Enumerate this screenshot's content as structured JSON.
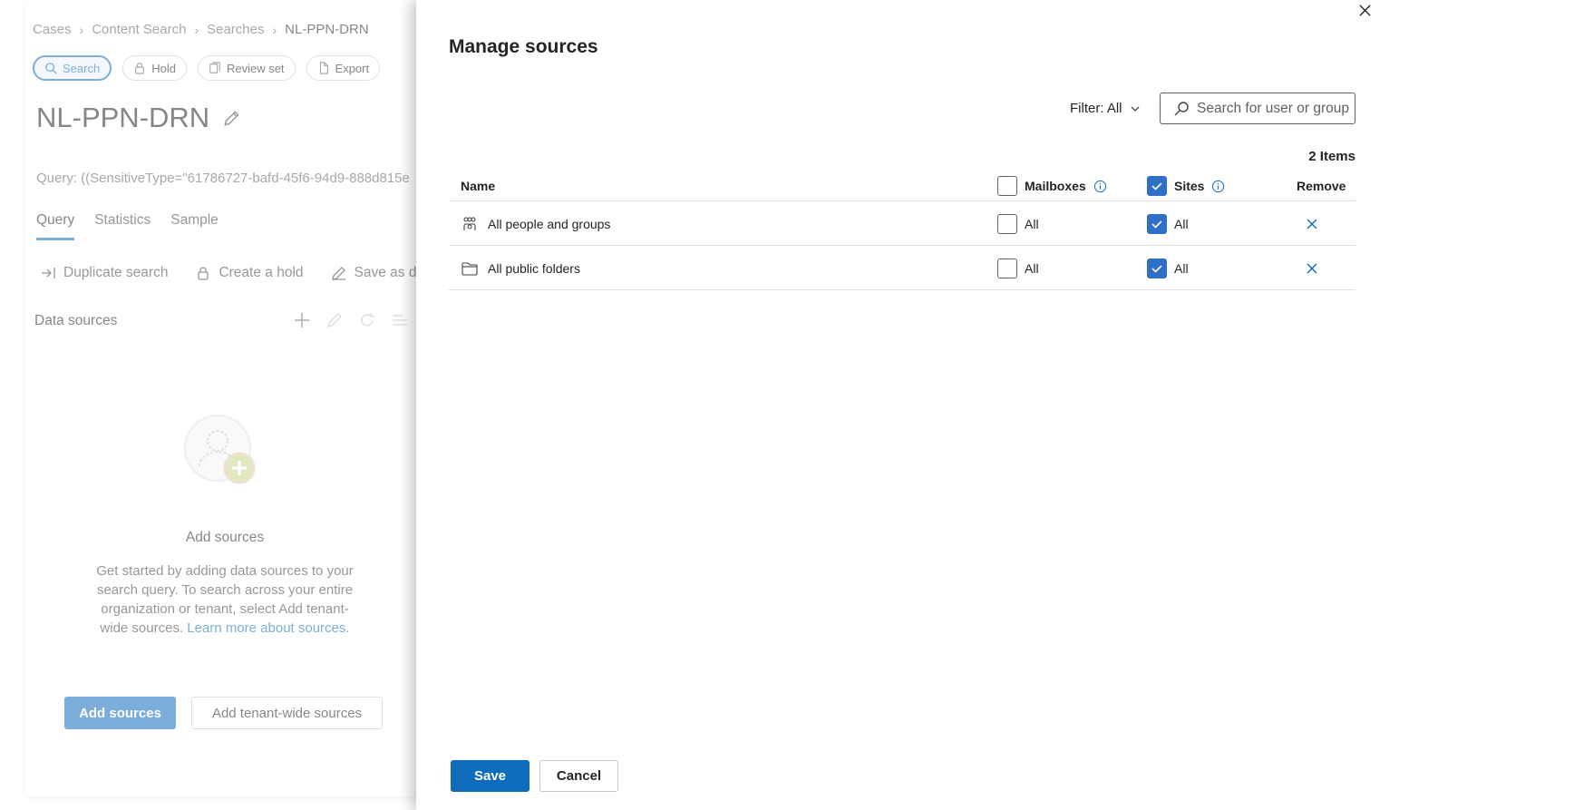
{
  "background": {
    "breadcrumb": [
      "Cases",
      "Content Search",
      "Searches",
      "NL-PPN-DRN"
    ],
    "actions": [
      {
        "label": "Search",
        "icon": "search-icon",
        "active": true
      },
      {
        "label": "Hold",
        "icon": "lock-icon",
        "active": false
      },
      {
        "label": "Review set",
        "icon": "review-set-icon",
        "active": false
      },
      {
        "label": "Export",
        "icon": "document-icon",
        "active": false
      }
    ],
    "title": "NL-PPN-DRN",
    "query": "Query: ((SensitiveType=\"61786727-bafd-45f6-94d9-888d815e",
    "tabs": [
      "Query",
      "Statistics",
      "Sample"
    ],
    "commands": [
      "Duplicate search",
      "Create a hold",
      "Save as d"
    ],
    "data_sources_label": "Data sources",
    "empty_state": {
      "title": "Add sources",
      "body": "Get started by adding data sources to your search query. To search across your entire organization or tenant, select Add tenant-wide sources.",
      "link": "Learn more about sources."
    },
    "add_sources_label": "Add sources",
    "add_tenant_label": "Add tenant-wide sources"
  },
  "panel": {
    "title": "Manage sources",
    "filter_label": "Filter: All",
    "search_placeholder": "Search for user or group",
    "items_count": "2 Items",
    "columns": {
      "name": "Name",
      "mailboxes": "Mailboxes",
      "sites": "Sites",
      "remove": "Remove"
    },
    "header_mailboxes_checked": false,
    "header_sites_checked": true,
    "rows": [
      {
        "name": "All people and groups",
        "icon": "people-group-icon",
        "mailboxes": "All",
        "mailboxes_checked": false,
        "sites": "All",
        "sites_checked": true
      },
      {
        "name": "All public folders",
        "icon": "folder-icon",
        "mailboxes": "All",
        "mailboxes_checked": false,
        "sites": "All",
        "sites_checked": true
      }
    ],
    "save_label": "Save",
    "cancel_label": "Cancel"
  },
  "colors": {
    "accent": "#0f6cbd",
    "checkbox_checked": "#2f6fc8",
    "text": "#242424"
  }
}
